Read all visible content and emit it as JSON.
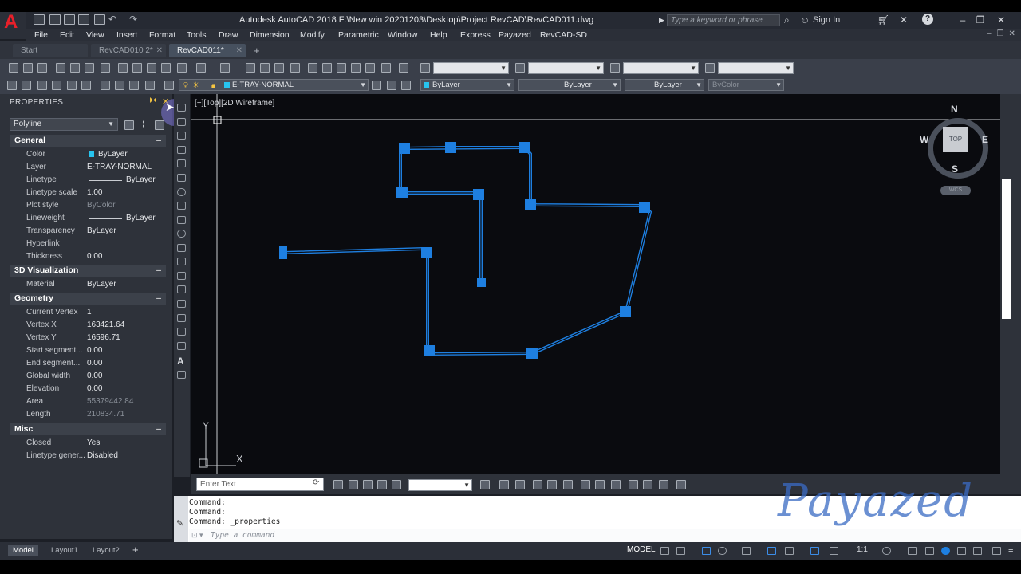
{
  "app": {
    "title": "Autodesk AutoCAD 2018    F:\\New win 20201203\\Desktop\\Project RevCAD\\RevCAD011.dwg",
    "logo_letter": "A",
    "search_placeholder": "Type a keyword or phrase",
    "sign_in": "Sign In"
  },
  "menu": [
    "File",
    "Edit",
    "View",
    "Insert",
    "Format",
    "Tools",
    "Draw",
    "Dimension",
    "Modify",
    "Parametric",
    "Window",
    "Help",
    "Express",
    "Payazed",
    "RevCAD-SD"
  ],
  "tabs": [
    {
      "label": "Start"
    },
    {
      "label": "RevCAD010 2*"
    },
    {
      "label": "RevCAD011*"
    }
  ],
  "toolbar": {
    "layer": "E-TRAY-NORMAL",
    "color": "ByLayer",
    "linetype": "ByLayer",
    "lineweight": "ByLayer",
    "plotstyle": "ByColor"
  },
  "properties": {
    "title": "PROPERTIES",
    "object_type": "Polyline",
    "sections": {
      "general": {
        "title": "General",
        "rows": [
          {
            "label": "Color",
            "value": "ByLayer"
          },
          {
            "label": "Layer",
            "value": "E-TRAY-NORMAL"
          },
          {
            "label": "Linetype",
            "value": "ByLayer"
          },
          {
            "label": "Linetype scale",
            "value": "1.00"
          },
          {
            "label": "Plot style",
            "value": "ByColor"
          },
          {
            "label": "Lineweight",
            "value": "ByLayer"
          },
          {
            "label": "Transparency",
            "value": "ByLayer"
          },
          {
            "label": "Hyperlink",
            "value": ""
          },
          {
            "label": "Thickness",
            "value": "0.00"
          }
        ]
      },
      "viz3d": {
        "title": "3D Visualization",
        "rows": [
          {
            "label": "Material",
            "value": "ByLayer"
          }
        ]
      },
      "geometry": {
        "title": "Geometry",
        "rows": [
          {
            "label": "Current Vertex",
            "value": "1"
          },
          {
            "label": "Vertex X",
            "value": "163421.64"
          },
          {
            "label": "Vertex Y",
            "value": "16596.71"
          },
          {
            "label": "Start segment...",
            "value": "0.00"
          },
          {
            "label": "End segment...",
            "value": "0.00"
          },
          {
            "label": "Global width",
            "value": "0.00"
          },
          {
            "label": "Elevation",
            "value": "0.00"
          },
          {
            "label": "Area",
            "value": "55379442.84"
          },
          {
            "label": "Length",
            "value": "210834.71"
          }
        ]
      },
      "misc": {
        "title": "Misc",
        "rows": [
          {
            "label": "Closed",
            "value": "Yes"
          },
          {
            "label": "Linetype gener...",
            "value": "Disabled"
          }
        ]
      }
    }
  },
  "viewport": {
    "label": "[−][Top][2D Wireframe]",
    "compass": {
      "n": "N",
      "s": "S",
      "e": "E",
      "w": "W",
      "top": "TOP",
      "wcs": "WCS"
    },
    "ucs_y": "Y",
    "ucs_x": "X"
  },
  "enter_text_placeholder": "Enter Text",
  "command": {
    "history": [
      "Command:",
      "Command:",
      "Command:  _properties"
    ],
    "placeholder": "Type a command"
  },
  "layout_tabs": [
    "Model",
    "Layout1",
    "Layout2"
  ],
  "status": {
    "model": "MODEL",
    "scale": "1:1"
  },
  "watermark": "Payazed",
  "colors": {
    "tray_blue": "#1e7fe0",
    "canvas_bg": "#0a0b0f",
    "accent_red": "#e8202a"
  }
}
